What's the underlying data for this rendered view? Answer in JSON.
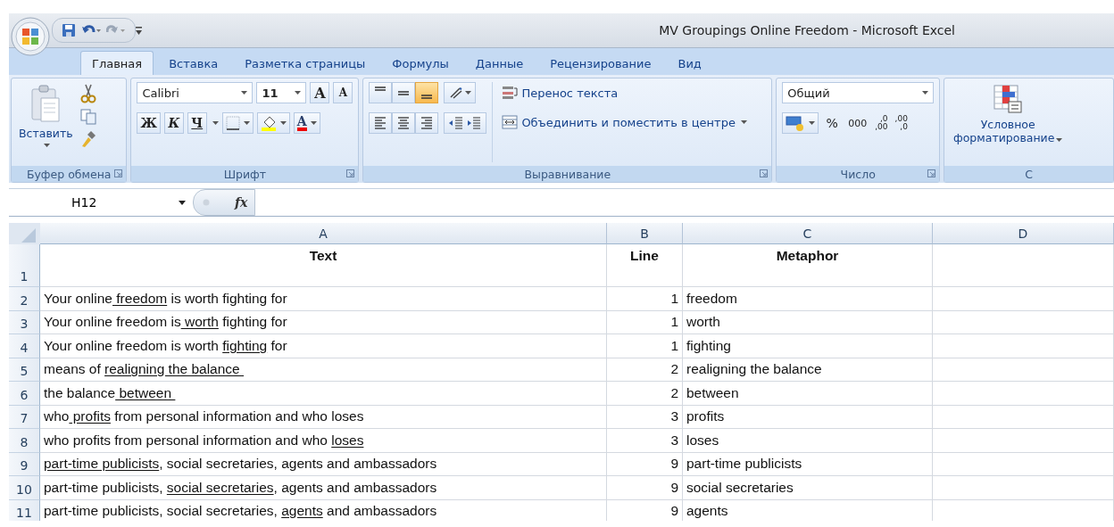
{
  "window": {
    "title": "MV Groupings Online Freedom - Microsoft Excel"
  },
  "tabs": [
    {
      "label": "Главная",
      "selected": true
    },
    {
      "label": "Вставка",
      "selected": false
    },
    {
      "label": "Разметка страницы",
      "selected": false
    },
    {
      "label": "Формулы",
      "selected": false
    },
    {
      "label": "Данные",
      "selected": false
    },
    {
      "label": "Рецензирование",
      "selected": false
    },
    {
      "label": "Вид",
      "selected": false
    }
  ],
  "ribbon": {
    "clipboard": {
      "paste": "Вставить",
      "label": "Буфер обмена"
    },
    "font": {
      "name": "Calibri",
      "size": "11",
      "grow": "A",
      "shrink": "A",
      "styles": [
        "Ж",
        "К",
        "Ч"
      ],
      "font_color": "A",
      "label": "Шрифт"
    },
    "alignment": {
      "vertical": [
        {
          "selected": false
        },
        {
          "selected": false
        },
        {
          "selected": true
        }
      ],
      "horizontal": [
        {
          "selected": false
        },
        {
          "selected": false
        },
        {
          "selected": false
        }
      ],
      "wrap": "Перенос текста",
      "merge": "Объединить и поместить в центре",
      "label": "Выравнивание"
    },
    "number": {
      "format": "Общий",
      "percent": "%",
      "thousands": "000",
      "decimals": [
        {
          "top": ",0",
          "bottom": ",00"
        },
        {
          "top": ",00",
          "bottom": ",0"
        }
      ],
      "label": "Число"
    },
    "styles": {
      "conditional": "Условное форматирование",
      "label": "С"
    }
  },
  "formula_bar": {
    "name_box": "H12",
    "function_symbol": "fx"
  },
  "sheet": {
    "columns": [
      "A",
      "B",
      "C",
      "D"
    ],
    "header": {
      "row": "1",
      "text": "Text",
      "line": "Line",
      "metaphor": "Metaphor"
    },
    "rows": [
      {
        "row": "2",
        "text": [
          {
            "text": "Your online",
            "underlined": false
          },
          {
            "text": " freedom",
            "underlined": true
          },
          {
            "text": " is worth fighting for",
            "underlined": false
          }
        ],
        "line": "1",
        "metaphor": "freedom"
      },
      {
        "row": "3",
        "text": [
          {
            "text": "Your online freedom is",
            "underlined": false
          },
          {
            "text": " worth",
            "underlined": true
          },
          {
            "text": " fighting for",
            "underlined": false
          }
        ],
        "line": "1",
        "metaphor": "worth"
      },
      {
        "row": "4",
        "text": [
          {
            "text": "Your online freedom is worth ",
            "underlined": false
          },
          {
            "text": "fighting",
            "underlined": true
          },
          {
            "text": " for",
            "underlined": false
          }
        ],
        "line": "1",
        "metaphor": "fighting"
      },
      {
        "row": "5",
        "text": [
          {
            "text": "means of ",
            "underlined": false
          },
          {
            "text": "realigning the balance ",
            "underlined": true
          }
        ],
        "line": "2",
        "metaphor": "realigning the balance"
      },
      {
        "row": "6",
        "text": [
          {
            "text": "the balance",
            "underlined": false
          },
          {
            "text": " between ",
            "underlined": true
          }
        ],
        "line": "2",
        "metaphor": "between"
      },
      {
        "row": "7",
        "text": [
          {
            "text": "who",
            "underlined": false
          },
          {
            "text": " profits",
            "underlined": true
          },
          {
            "text": " from personal information and who loses",
            "underlined": false
          }
        ],
        "line": "3",
        "metaphor": "profits"
      },
      {
        "row": "8",
        "text": [
          {
            "text": "who profits from personal information and who ",
            "underlined": false
          },
          {
            "text": "loses",
            "underlined": true
          }
        ],
        "line": "3",
        "metaphor": "loses"
      },
      {
        "row": "9",
        "text": [
          {
            "text": "part-time publicists",
            "underlined": true
          },
          {
            "text": ", social secretaries, agents and ambassadors",
            "underlined": false
          }
        ],
        "line": "9",
        "metaphor": "part-time publicists"
      },
      {
        "row": "10",
        "text": [
          {
            "text": "part-time publicists, ",
            "underlined": false
          },
          {
            "text": "social secretaries",
            "underlined": true
          },
          {
            "text": ", agents and ambassadors",
            "underlined": false
          }
        ],
        "line": "9",
        "metaphor": "social secretaries"
      },
      {
        "row": "11",
        "text": [
          {
            "text": "part-time publicists, social secretaries, ",
            "underlined": false
          },
          {
            "text": "agents",
            "underlined": true
          },
          {
            "text": " and ambassadors",
            "underlined": false
          }
        ],
        "line": "9",
        "metaphor": "agents"
      }
    ]
  }
}
